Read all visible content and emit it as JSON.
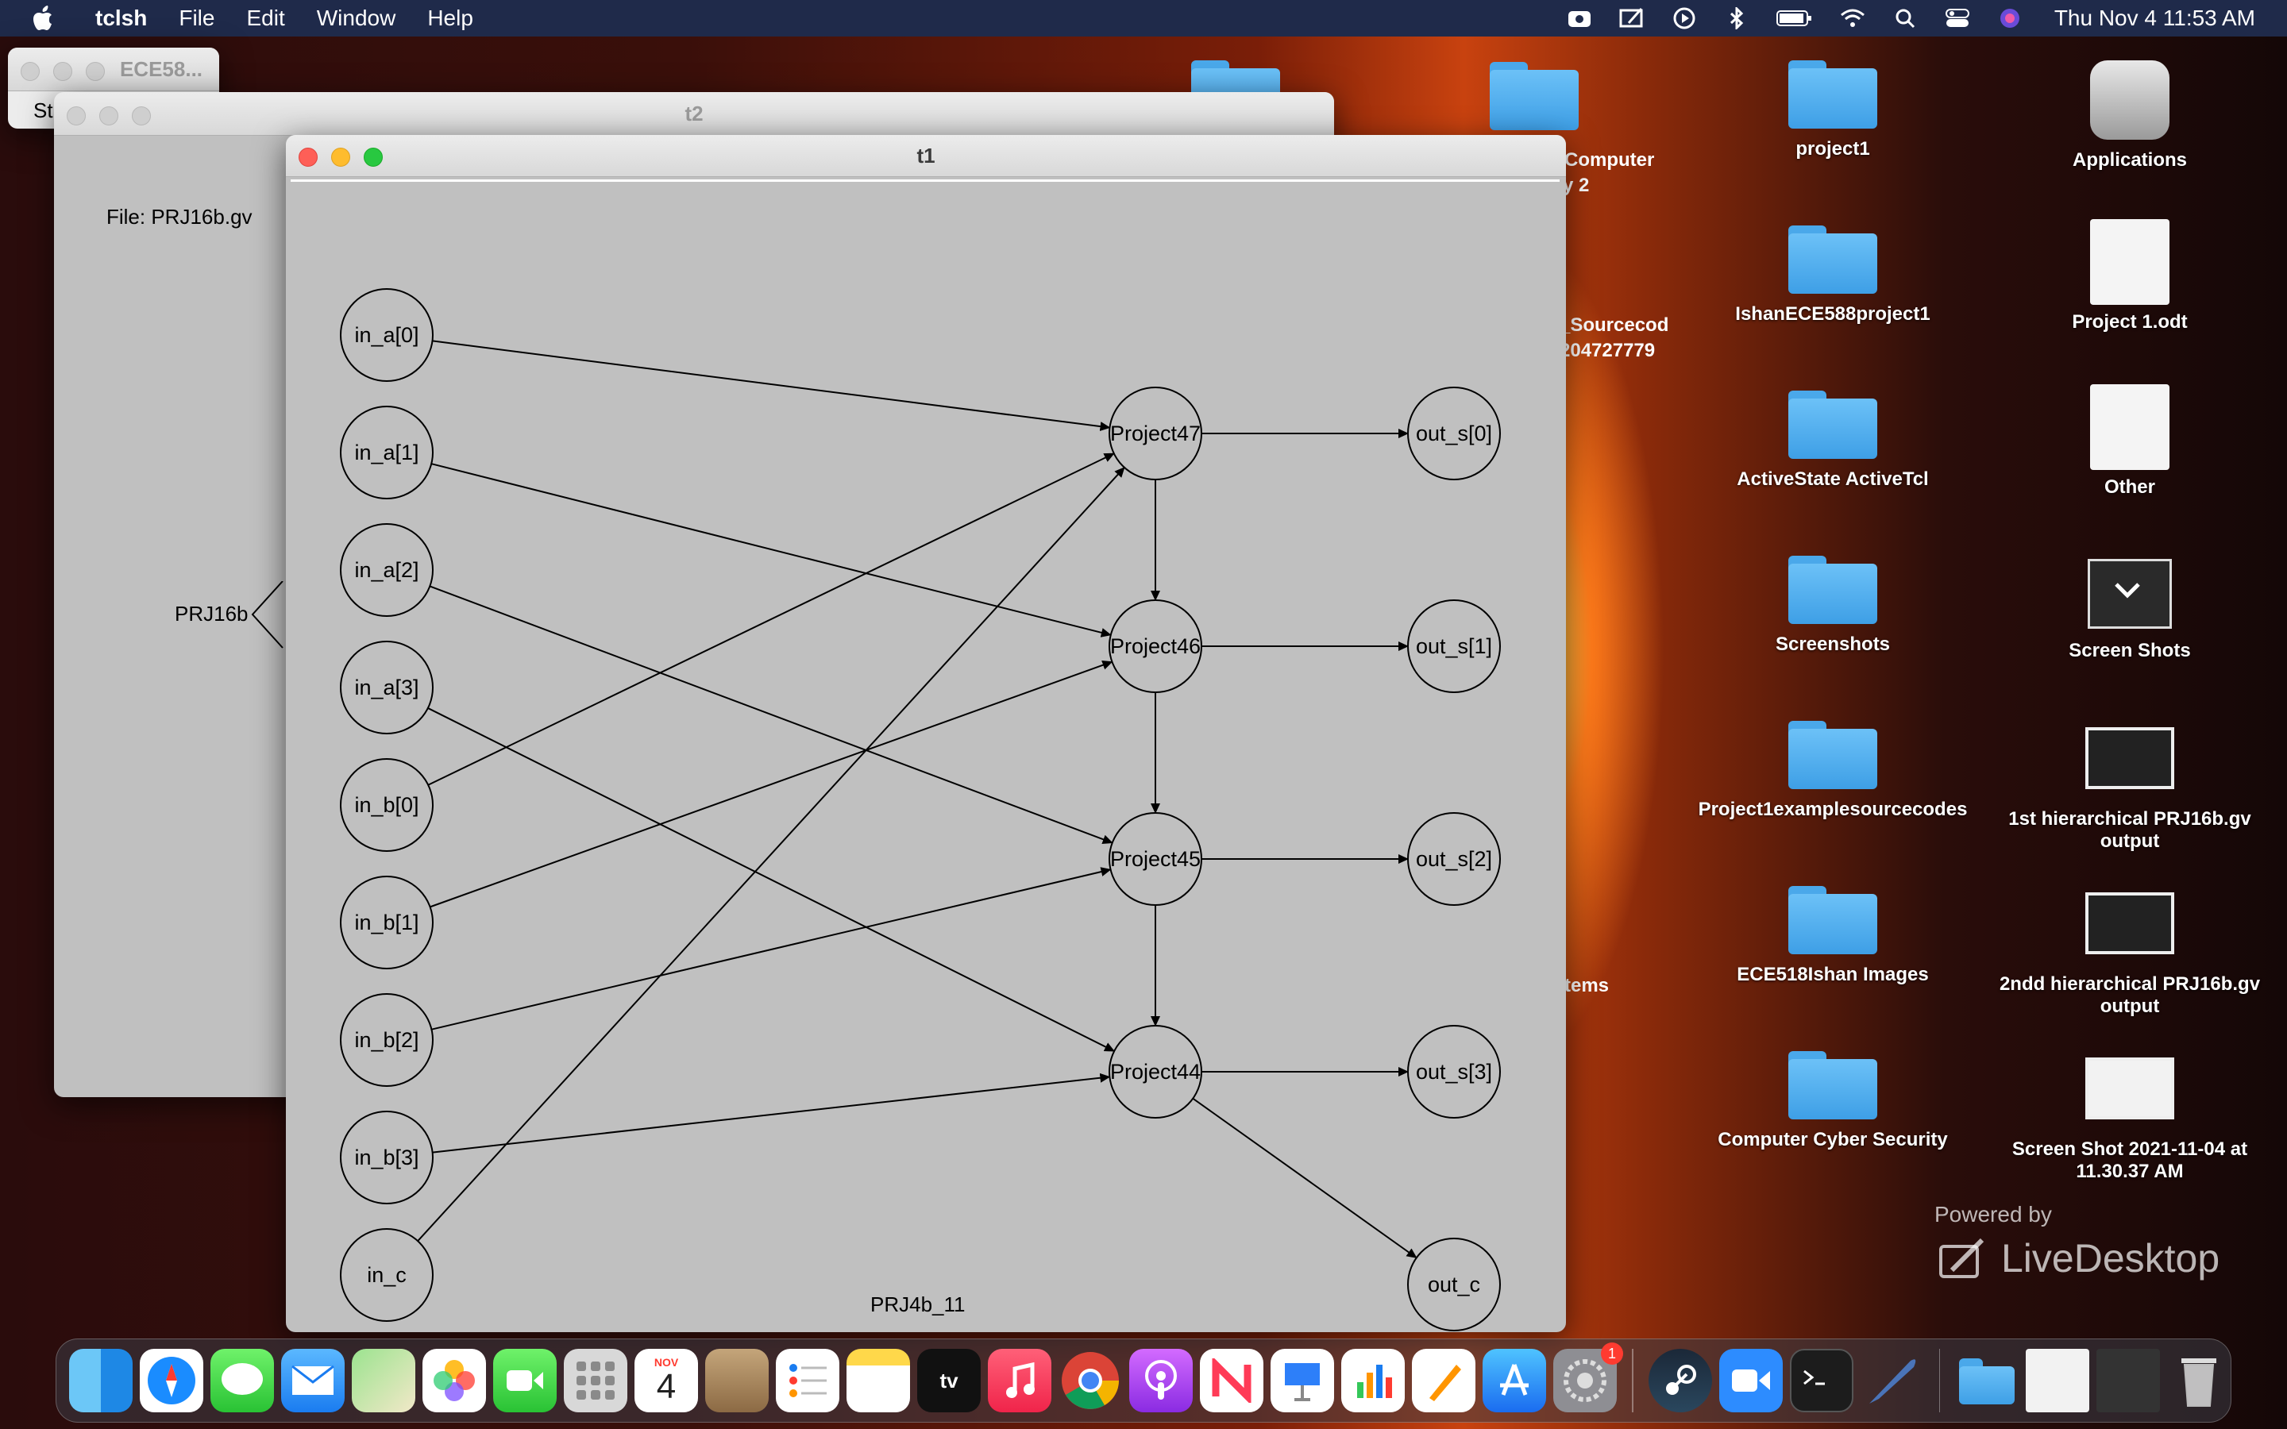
{
  "menubar": {
    "app": "tclsh",
    "items": [
      "File",
      "Edit",
      "Window",
      "Help"
    ],
    "clock": "Thu Nov 4  11:53 AM"
  },
  "windows": {
    "ece": {
      "title": "ECE58...",
      "partial_text": "St"
    },
    "t2": {
      "title": "t2",
      "file_label": "File: PRJ16b.gv",
      "node_label": "PRJ16b"
    },
    "t1": {
      "title": "t1",
      "graph_label": "PRJ4b_11"
    }
  },
  "graph": {
    "inputs": [
      "in_a[0]",
      "in_a[1]",
      "in_a[2]",
      "in_a[3]",
      "in_b[0]",
      "in_b[1]",
      "in_b[2]",
      "in_b[3]",
      "in_c"
    ],
    "modules": [
      "Project47",
      "Project46",
      "Project45",
      "Project44"
    ],
    "outputs": [
      "out_s[0]",
      "out_s[1]",
      "out_s[2]",
      "out_s[3]",
      "out_c"
    ],
    "edges": [
      [
        "in_a[0]",
        "Project47"
      ],
      [
        "in_b[0]",
        "Project47"
      ],
      [
        "in_c",
        "Project47"
      ],
      [
        "in_a[1]",
        "Project46"
      ],
      [
        "in_b[1]",
        "Project46"
      ],
      [
        "in_a[2]",
        "Project45"
      ],
      [
        "in_b[2]",
        "Project45"
      ],
      [
        "in_a[3]",
        "Project44"
      ],
      [
        "in_b[3]",
        "Project44"
      ],
      [
        "Project47",
        "Project46"
      ],
      [
        "Project46",
        "Project45"
      ],
      [
        "Project45",
        "Project44"
      ],
      [
        "Project47",
        "out_s[0]"
      ],
      [
        "Project46",
        "out_s[1]"
      ],
      [
        "Project45",
        "out_s[2]"
      ],
      [
        "Project44",
        "out_s[3]"
      ],
      [
        "Project44",
        "out_c"
      ]
    ]
  },
  "desktop": {
    "partial": [
      "Computer",
      "y 2",
      "_Sourcecod",
      "204727779",
      "tems"
    ],
    "items": [
      {
        "label": "project1",
        "type": "folder"
      },
      {
        "label": "Applications",
        "type": "app"
      },
      {
        "label": "IshanECE588project1",
        "type": "folder"
      },
      {
        "label": "Project 1.odt",
        "type": "doc"
      },
      {
        "label": "ActiveState ActiveTcl",
        "type": "folder"
      },
      {
        "label": "Other",
        "type": "doc"
      },
      {
        "label": "Screenshots",
        "type": "folder"
      },
      {
        "label": "Screen Shots",
        "type": "folder-dark"
      },
      {
        "label": "Project1examplesourcecodes",
        "type": "folder"
      },
      {
        "label": "1st hierarchical PRJ16b.gv output",
        "type": "thumb"
      },
      {
        "label": "ECE518Ishan Images",
        "type": "folder"
      },
      {
        "label": "2ndd hierarchical PRJ16b.gv output",
        "type": "thumb"
      },
      {
        "label": "Computer Cyber Security",
        "type": "folder"
      },
      {
        "label": "Screen Shot 2021-11-04 at 11.30.37 AM",
        "type": "thumb"
      }
    ],
    "watermark": {
      "powered": "Powered by",
      "brand": "LiveDesktop"
    }
  },
  "dock": {
    "calendar_month": "NOV",
    "calendar_day": "4",
    "badge": "1",
    "icons": [
      "finder-icon",
      "safari-icon",
      "messages-icon",
      "mail-icon",
      "maps-icon",
      "photos-icon",
      "facetime-icon",
      "launchpad-icon",
      "calendar-icon",
      "contacts-icon",
      "reminders-icon",
      "notes-icon",
      "appletv-icon",
      "music-icon",
      "chrome-icon",
      "podcasts-icon",
      "news-icon",
      "keynote-icon",
      "numbers-icon",
      "pages-icon",
      "appstore-icon",
      "systemprefs-icon",
      "steam-icon",
      "zoom-icon",
      "terminal-icon",
      "feather-icon",
      "downloads-folder-icon",
      "window-preview-icon",
      "screenshot-preview-icon",
      "trash-icon"
    ]
  }
}
